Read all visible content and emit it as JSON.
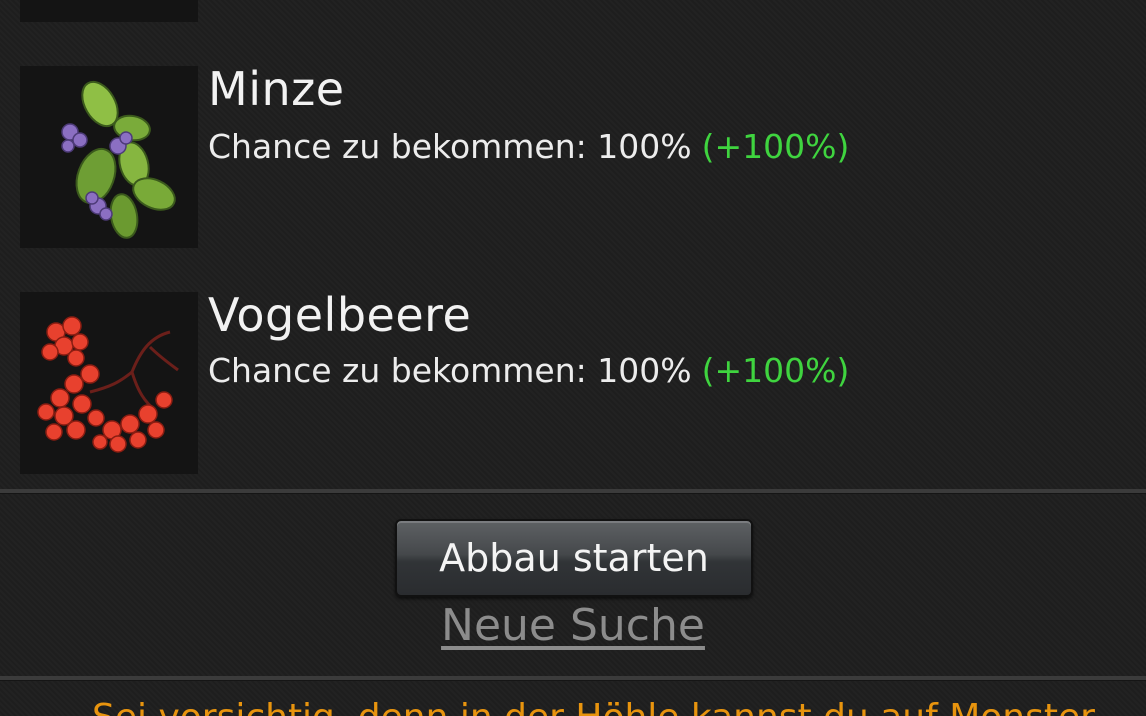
{
  "resources": [
    {
      "name": "Minze",
      "chance_label": "Chance zu bekommen: 100%",
      "bonus": "(+100%)",
      "icon": "mint-leaves-icon"
    },
    {
      "name": "Vogelbeere",
      "chance_label": "Chance zu bekommen: 100%",
      "bonus": "(+100%)",
      "icon": "rowanberry-icon"
    }
  ],
  "actions": {
    "start_label": "Abbau starten",
    "new_search_label": "Neue Suche"
  },
  "footer": {
    "hint_partial": "Sei vorsichtig, denn in der Höhle kannst du auf Monster"
  },
  "colors": {
    "bonus": "#3fd43f",
    "hint": "#e8940e",
    "background": "#1f1f1f"
  }
}
